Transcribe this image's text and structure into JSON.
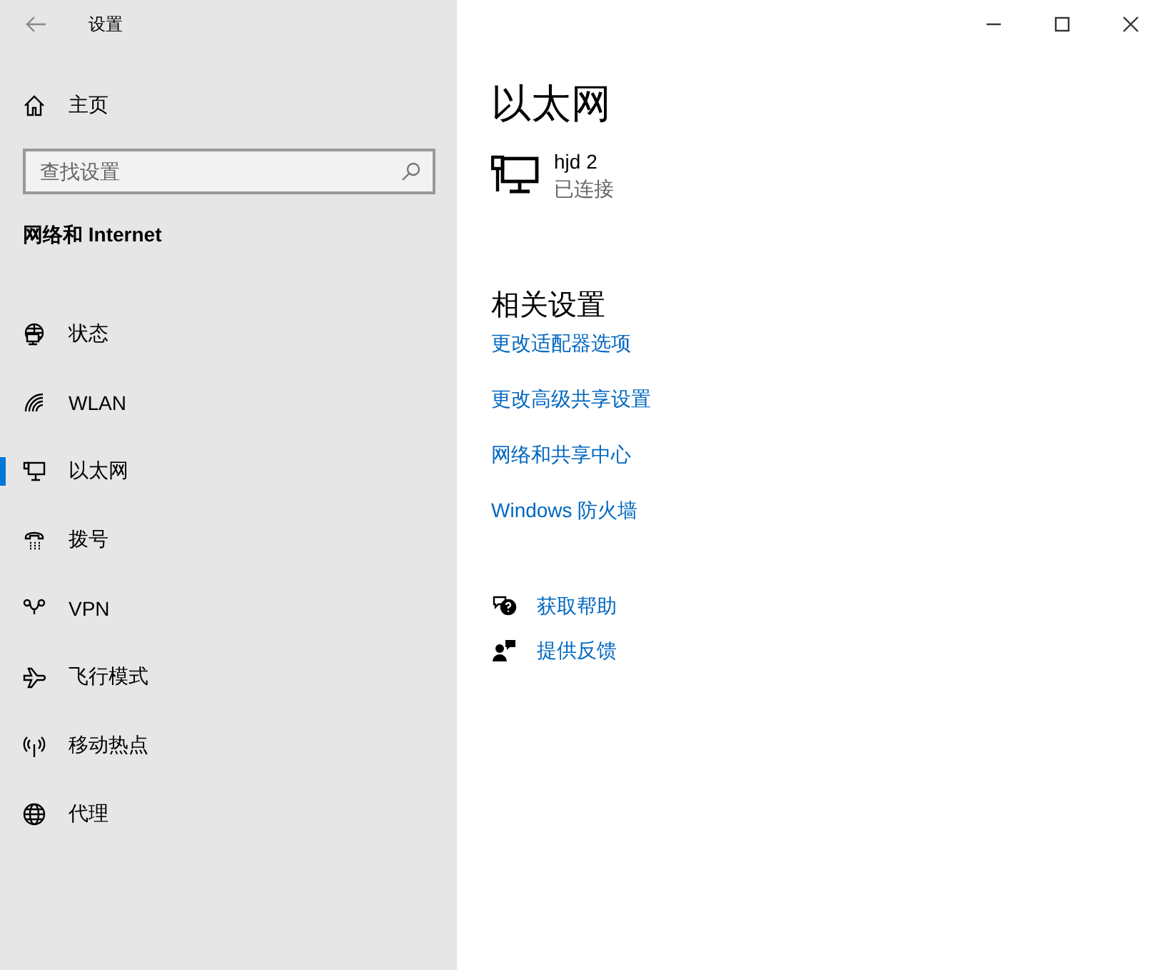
{
  "window": {
    "title": "设置"
  },
  "sidebar": {
    "home": "主页",
    "search": {
      "placeholder": "查找设置"
    },
    "section": "网络和 Internet",
    "items": [
      {
        "label": "状态",
        "selected": false
      },
      {
        "label": "WLAN",
        "selected": false
      },
      {
        "label": "以太网",
        "selected": true
      },
      {
        "label": "拨号",
        "selected": false
      },
      {
        "label": "VPN",
        "selected": false
      },
      {
        "label": "飞行模式",
        "selected": false
      },
      {
        "label": "移动热点",
        "selected": false
      },
      {
        "label": "代理",
        "selected": false
      }
    ]
  },
  "page": {
    "title": "以太网",
    "adapter": {
      "name": "hjd 2",
      "status": "已连接"
    },
    "related_title": "相关设置",
    "related_links": [
      "更改适配器选项",
      "更改高级共享设置",
      "网络和共享中心",
      "Windows 防火墙"
    ],
    "help_links": [
      {
        "kind": "help",
        "label": "获取帮助"
      },
      {
        "kind": "feedback",
        "label": "提供反馈"
      }
    ]
  }
}
